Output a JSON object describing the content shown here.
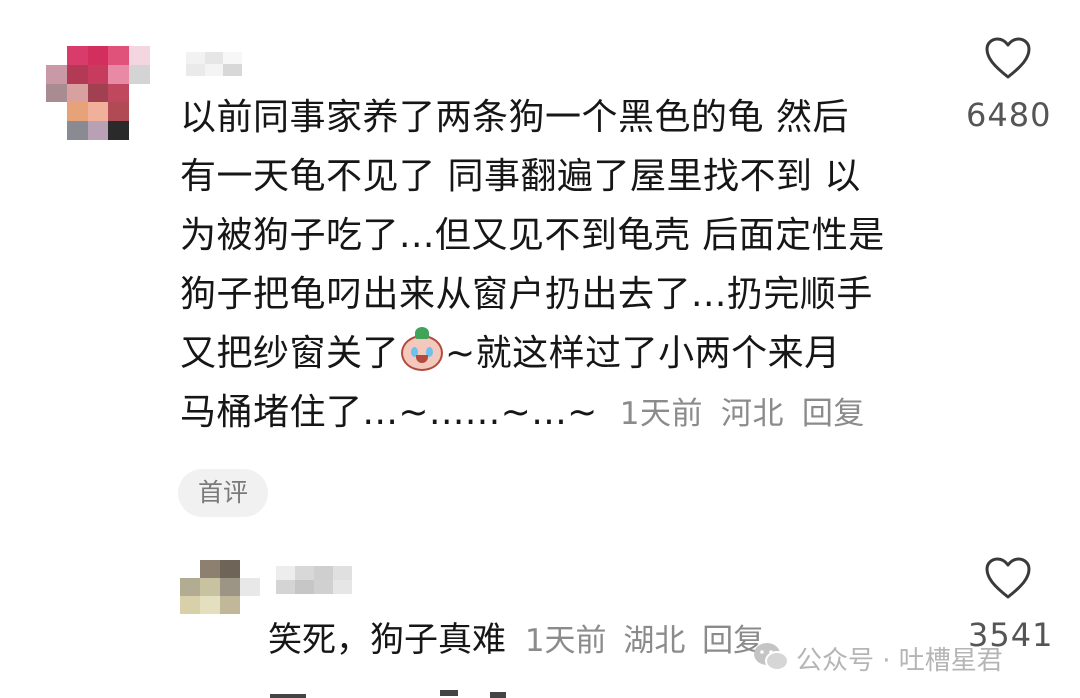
{
  "comment": {
    "lines": [
      "以前同事家养了两条狗一个黑色的龟 然后",
      "有一天龟不见了 同事翻遍了屋里找不到 以",
      "为被狗子吃了...但又见不到龟壳 后面定性是",
      "狗子把龟叼出来从窗户扔出去了...扔完顺手",
      "又把纱窗关了",
      "~就这样过了小两个来月",
      "马桶堵住了...~......~...~"
    ],
    "emoji": "crying-face-emoji",
    "time": "1天前",
    "location": "河北",
    "reply_label": "回复",
    "like_count": "6480",
    "badge": "首评"
  },
  "reply": {
    "text": "笑死，狗子真难",
    "time": "1天前",
    "location": "湖北",
    "reply_label": "回复",
    "like_count": "3541"
  },
  "watermark": {
    "text": "公众号 · 吐槽星君"
  },
  "icons": {
    "like": "heart-outline-icon",
    "watermark": "wechat-icon"
  },
  "colors": {
    "text": "#161616",
    "meta": "#8b8b8b",
    "badge_bg": "#f1f1f1"
  }
}
